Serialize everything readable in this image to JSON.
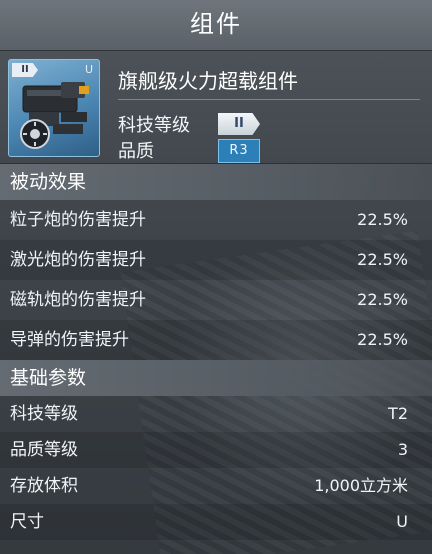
{
  "title": "组件",
  "item": {
    "icon_tier": "II",
    "icon_size": "U",
    "name": "旗舰级火力超载组件",
    "tech_label": "科技等级",
    "tech_badge": "II",
    "quality_label": "品质",
    "quality_badge": "R3"
  },
  "passive": {
    "header": "被动效果",
    "rows": [
      {
        "label": "粒子炮的伤害提升",
        "value": "22.5%"
      },
      {
        "label": "激光炮的伤害提升",
        "value": "22.5%"
      },
      {
        "label": "磁轨炮的伤害提升",
        "value": "22.5%"
      },
      {
        "label": "导弹的伤害提升",
        "value": "22.5%"
      }
    ]
  },
  "basic": {
    "header": "基础参数",
    "rows": [
      {
        "label": "科技等级",
        "value": "T2"
      },
      {
        "label": "品质等级",
        "value": "3"
      },
      {
        "label": "存放体积",
        "value": "1,000立方米"
      },
      {
        "label": "尺寸",
        "value": "U"
      }
    ]
  },
  "colors": {
    "accent_blue": "#2d7fb8",
    "icon_background": "#4b86b3"
  }
}
